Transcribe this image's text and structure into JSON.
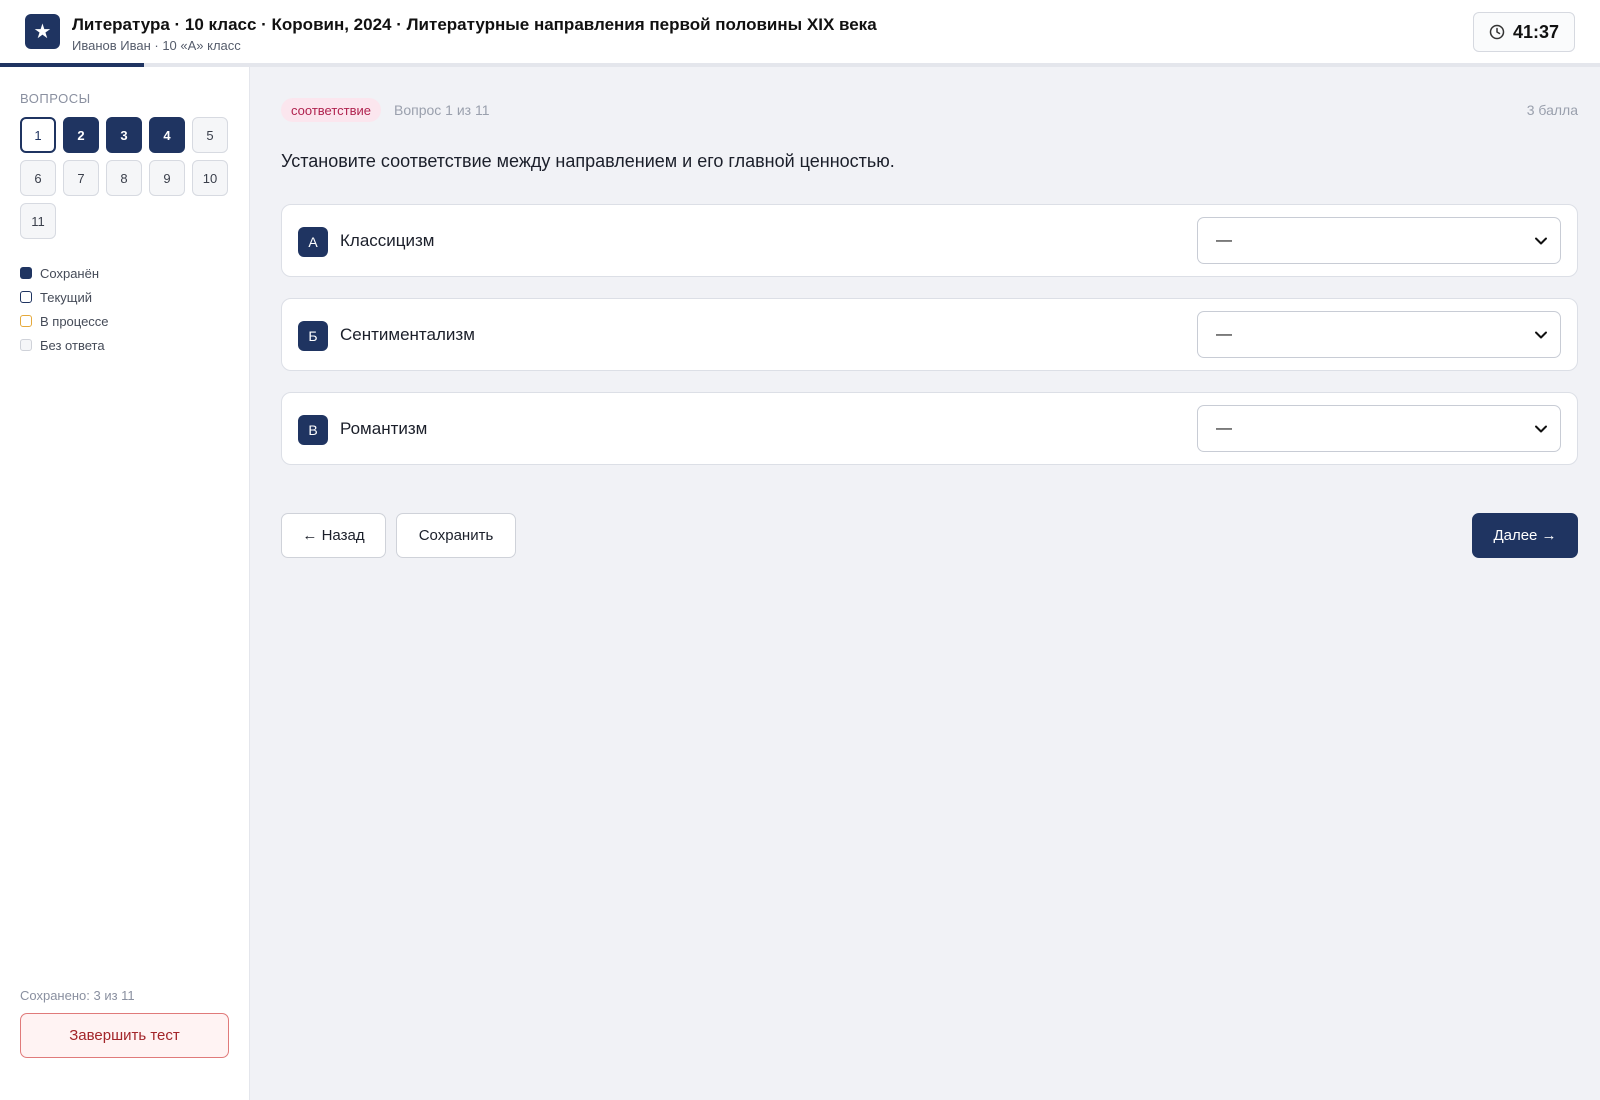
{
  "header": {
    "logo_glyph": "★",
    "title": "Литература · 10 класс · Коровин, 2024 · Литературные направления первой половины XIX века",
    "subtitle": "Иванов Иван · 10 «А» класс",
    "timer": "41:37",
    "progress_fraction": 0.09
  },
  "sidebar": {
    "heading": "Вопросы",
    "questions": [
      {
        "num": "1",
        "state": "current"
      },
      {
        "num": "2",
        "state": "saved"
      },
      {
        "num": "3",
        "state": "saved"
      },
      {
        "num": "4",
        "state": "saved"
      },
      {
        "num": "5",
        "state": "empty"
      },
      {
        "num": "6",
        "state": "empty"
      },
      {
        "num": "7",
        "state": "empty"
      },
      {
        "num": "8",
        "state": "empty"
      },
      {
        "num": "9",
        "state": "empty"
      },
      {
        "num": "10",
        "state": "empty"
      },
      {
        "num": "11",
        "state": "empty"
      }
    ],
    "legend": [
      {
        "key": "saved",
        "label": "Сохранён"
      },
      {
        "key": "current",
        "label": "Текущий"
      },
      {
        "key": "progress",
        "label": "В процессе"
      },
      {
        "key": "empty",
        "label": "Без ответа"
      }
    ],
    "saved_count": "Сохранено: 3 из 11",
    "finish_label": "Завершить тест"
  },
  "main": {
    "type_badge": "соответствие",
    "question_number": "Вопрос 1 из 11",
    "points": "3 балла",
    "question_text": "Установите соответствие между направлением и его главной ценностью.",
    "rows": [
      {
        "letter": "А",
        "label": "Классицизм",
        "selected": "—"
      },
      {
        "letter": "Б",
        "label": "Сентиментализм",
        "selected": "—"
      },
      {
        "letter": "В",
        "label": "Романтизм",
        "selected": "—"
      }
    ],
    "back_label": "← Назад",
    "save_label": "Сохранить",
    "next_label": "Далее →"
  },
  "colors": {
    "accent": "#1f3461",
    "badge_bg": "#fbe6ee",
    "badge_text": "#b0234f",
    "in_progress": "#e5a93c",
    "danger": "#a3252a"
  }
}
